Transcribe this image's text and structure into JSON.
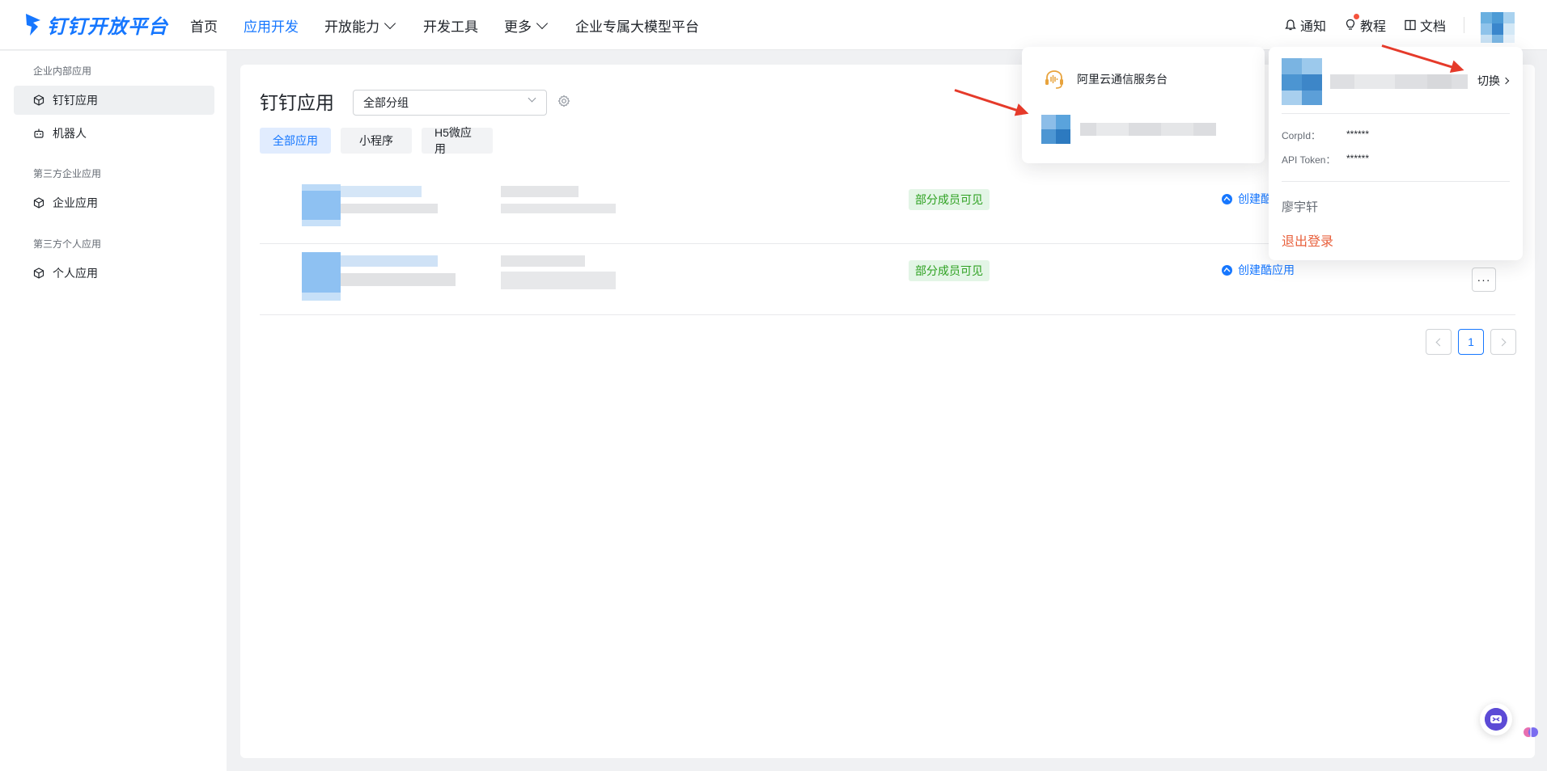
{
  "brand": {
    "name": "钉钉开放平台",
    "accent": "#1677ff"
  },
  "nav": {
    "items": [
      {
        "label": "首页",
        "dropdown": false,
        "active": false
      },
      {
        "label": "应用开发",
        "dropdown": false,
        "active": true
      },
      {
        "label": "开放能力",
        "dropdown": true,
        "active": false
      },
      {
        "label": "开发工具",
        "dropdown": false,
        "active": false
      },
      {
        "label": "更多",
        "dropdown": true,
        "active": false
      },
      {
        "label": "企业专属大模型平台",
        "dropdown": false,
        "active": false
      }
    ],
    "right": {
      "notify": "通知",
      "tutorial": "教程",
      "docs": "文档"
    }
  },
  "sidebar": {
    "groups": [
      {
        "title": "企业内部应用",
        "items": [
          {
            "label": "钉钉应用",
            "icon": "cube-icon",
            "active": true
          },
          {
            "label": "机器人",
            "icon": "robot-icon",
            "active": false
          }
        ]
      },
      {
        "title": "第三方企业应用",
        "items": [
          {
            "label": "企业应用",
            "icon": "cube-icon",
            "active": false
          }
        ]
      },
      {
        "title": "第三方个人应用",
        "items": [
          {
            "label": "个人应用",
            "icon": "cube-icon",
            "active": false
          }
        ]
      }
    ]
  },
  "main": {
    "title": "钉钉应用",
    "group_select": "全部分组",
    "tabs": [
      "全部应用",
      "小程序",
      "H5微应用"
    ],
    "rows": [
      {
        "status": "部分成员可见",
        "action": "创建酷应用",
        "status_color": "#2ea121"
      },
      {
        "status": "部分成员可见",
        "action": "创建酷应用",
        "status_color": "#2ea121"
      }
    ],
    "more_label": "···",
    "pager": {
      "current": "1"
    }
  },
  "org_popup": {
    "items": [
      {
        "name": "阿里云通信服务台",
        "icon": "headset-icon"
      }
    ]
  },
  "user_popup": {
    "switch_label": "切换",
    "corp_id_label": "CorpId：",
    "corp_id_value": "******",
    "api_token_label": "API Token：",
    "api_token_value": "******",
    "user_name": "廖宇轩",
    "logout_label": "退出登录"
  }
}
